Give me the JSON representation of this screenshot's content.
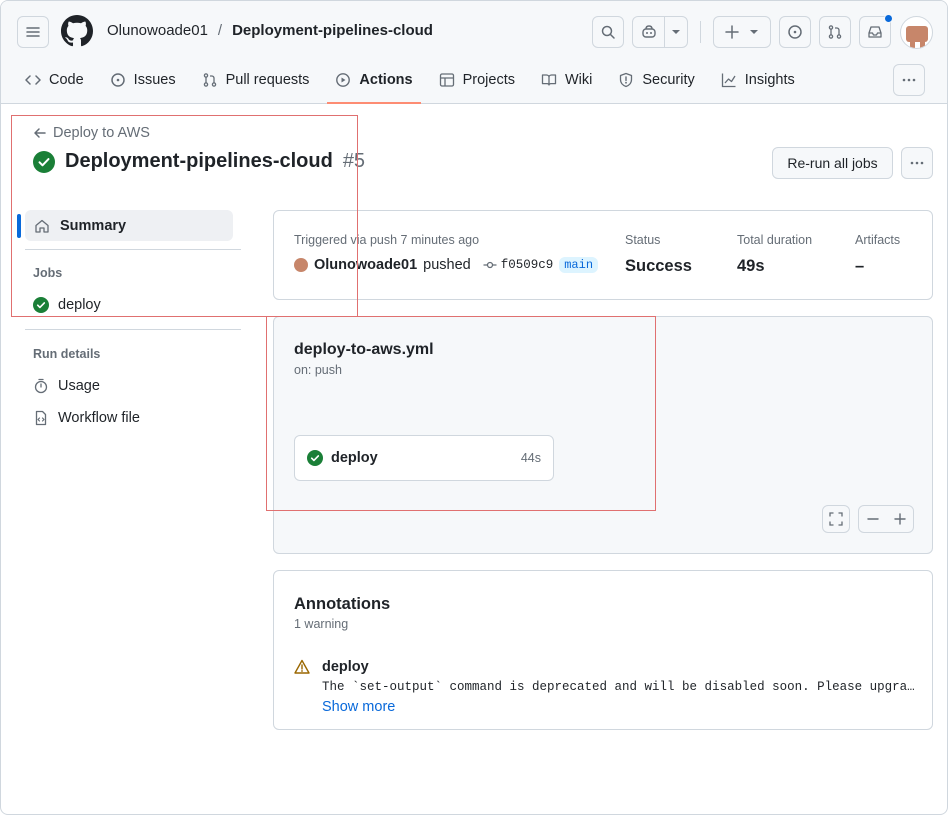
{
  "header": {
    "repo_owner": "Olunowoade01",
    "repo_separator": "/",
    "repo_name": "Deployment-pipelines-cloud",
    "tabs": [
      {
        "label": "Code",
        "icon": "code-icon"
      },
      {
        "label": "Issues",
        "icon": "issue-icon"
      },
      {
        "label": "Pull requests",
        "icon": "pull-request-icon"
      },
      {
        "label": "Actions",
        "icon": "play-icon",
        "active": true
      },
      {
        "label": "Projects",
        "icon": "table-icon"
      },
      {
        "label": "Wiki",
        "icon": "book-icon"
      },
      {
        "label": "Security",
        "icon": "shield-icon"
      },
      {
        "label": "Insights",
        "icon": "graph-icon"
      }
    ]
  },
  "run": {
    "back_label": "Deploy to AWS",
    "title": "Deployment-pipelines-cloud",
    "number": "#5",
    "rerun_label": "Re-run all jobs"
  },
  "sidebar": {
    "summary_label": "Summary",
    "jobs_heading": "Jobs",
    "jobs": [
      {
        "label": "deploy",
        "status": "success"
      }
    ],
    "run_details_heading": "Run details",
    "usage_label": "Usage",
    "workflow_file_label": "Workflow file"
  },
  "summary": {
    "triggered_label": "Triggered via push 7 minutes ago",
    "actor": "Olunowoade01",
    "action": "pushed",
    "commit": "f0509c9",
    "branch": "main",
    "status_label": "Status",
    "status_value": "Success",
    "duration_label": "Total duration",
    "duration_value": "49s",
    "artifacts_label": "Artifacts",
    "artifacts_value": "–"
  },
  "graph": {
    "workflow_name": "deploy-to-aws.yml",
    "trigger": "on: push",
    "job_name": "deploy",
    "job_duration": "44s"
  },
  "annotations": {
    "title": "Annotations",
    "count": "1 warning",
    "item_title": "deploy",
    "item_message": "The `set-output` command is deprecated and will be disabled soon. Please upgrade to using Environment Files.",
    "show_more": "Show more"
  },
  "colors": {
    "success": "#1a7f37",
    "accent": "#0969da",
    "tab_underline": "#fd8c73",
    "warning": "#9a6700",
    "highlight": "#e07070"
  }
}
